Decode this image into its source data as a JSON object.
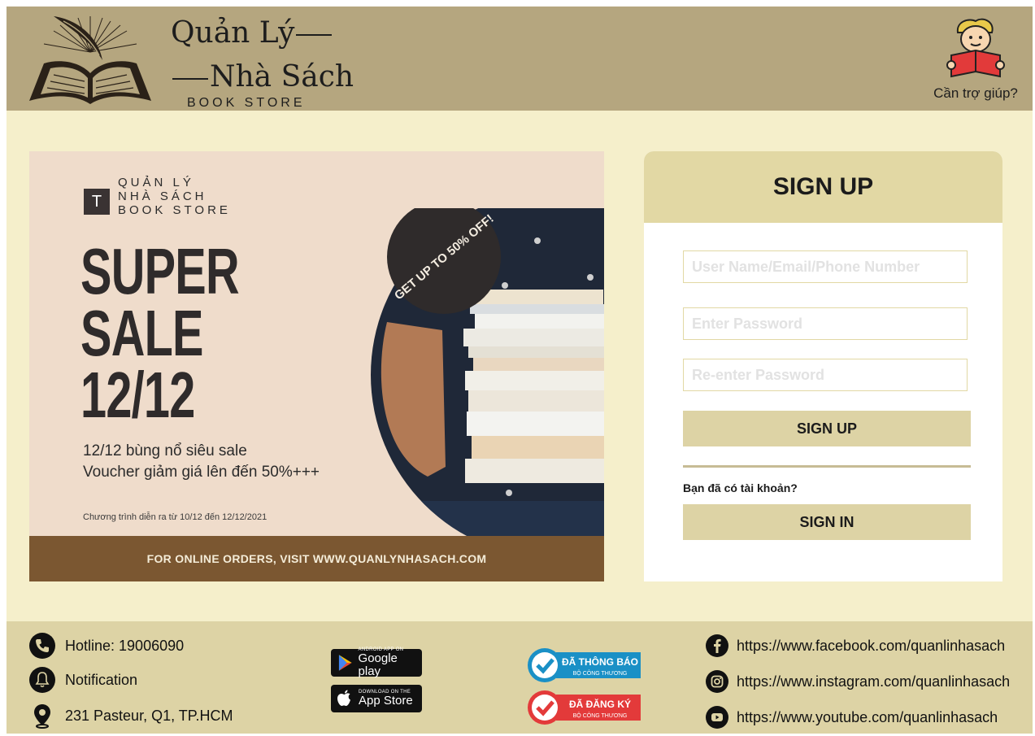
{
  "header": {
    "brand_line1": "Quản Lý",
    "brand_line2": "Nhà Sách",
    "brand_line3": "BOOK STORE",
    "help_label": "Cần trợ giúp?"
  },
  "banner": {
    "mini_logo_letter": "T",
    "mini_logo_lines": [
      "QUẢN LÝ",
      "NHÀ SÁCH",
      "BOOK STORE"
    ],
    "headline": [
      "SUPER",
      "SALE",
      "12/12"
    ],
    "desc_line1": "12/12 bùng nổ siêu sale",
    "desc_line2": "Voucher giảm giá lên đến 50%+++",
    "period": "Chương trình diễn ra từ 10/12 đến 12/12/2021",
    "badge_text": "GET UP TO 50% OFF!",
    "footer_text": "FOR ONLINE ORDERS, VISIT WWW.QUANLYNHASACH.COM"
  },
  "signup": {
    "title": "SIGN UP",
    "username_placeholder": "User Name/Email/Phone Number",
    "password_placeholder": "Enter Password",
    "repassword_placeholder": "Re-enter Password",
    "signup_button": "SIGN UP",
    "have_account": "Bạn đã có tài khoản?",
    "signin_button": "SIGN IN"
  },
  "footer": {
    "hotline": "Hotline: 19006090",
    "notification": "Notification",
    "address": "231 Pasteur, Q1, TP.HCM",
    "google_play_small": "ANDROID APP ON",
    "google_play": "Google play",
    "app_store_small": "DOWNLOAD ON THE",
    "app_store": "App Store",
    "badge_notified_title": "ĐÃ THÔNG BÁO",
    "badge_notified_sub": "BỘ CÔNG THƯƠNG",
    "badge_registered_title": "ĐÃ ĐĂNG KÝ",
    "badge_registered_sub": "BỘ CÔNG THƯƠNG",
    "facebook": "https://www.facebook.com/quanlinhasach",
    "instagram": "https://www.instagram.com/quanlinhasach",
    "youtube": "https://www.youtube.com/quanlinhasach"
  },
  "colors": {
    "header_bg": "#b5a67f",
    "page_bg": "#f5efcb",
    "accent": "#ddd3a5",
    "banner_bg": "#efdccb",
    "banner_footer": "#7b5731"
  },
  "icons": [
    "book-quill-logo-icon",
    "reader-help-icon",
    "phone-icon",
    "bell-icon",
    "location-pin-icon",
    "google-play-icon",
    "apple-icon",
    "check-badge-icon",
    "facebook-icon",
    "instagram-icon",
    "youtube-icon"
  ]
}
